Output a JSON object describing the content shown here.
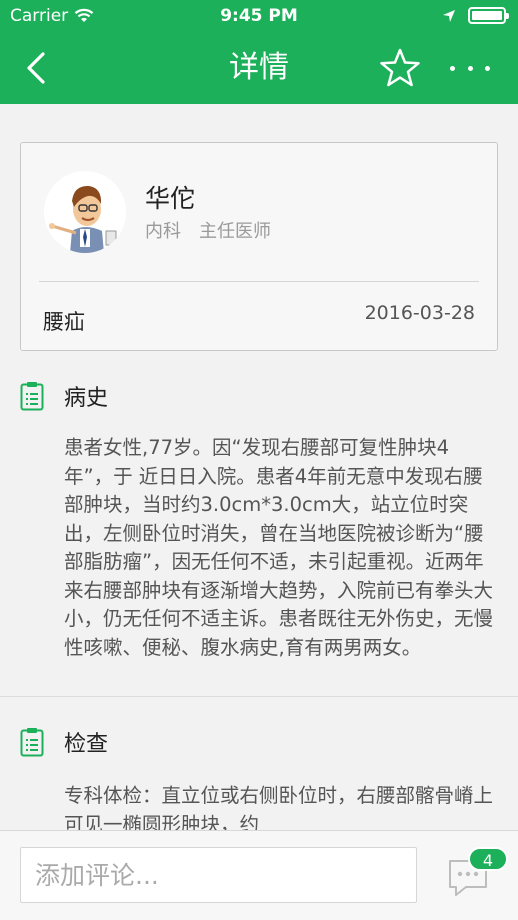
{
  "status_bar": {
    "carrier": "Carrier",
    "time": "9:45 PM"
  },
  "nav": {
    "title": "详情",
    "back_icon": "chevron-left-icon",
    "favorite_icon": "star-icon",
    "more_icon": "more-dots-icon"
  },
  "doctor": {
    "name": "华佗",
    "department": "内科",
    "title": "主任医师"
  },
  "record": {
    "diagnosis": "腰疝",
    "date": "2016-03-28"
  },
  "sections": [
    {
      "title": "病史",
      "icon": "clipboard-icon",
      "text": "患者女性,77岁。因“发现右腰部可复性肿块4年”，于 近日日入院。患者4年前无意中发现右腰部肿块，当时约3.0cm*3.0cm大，站立位时突出，左侧卧位时消失，曾在当地医院被诊断为“腰部脂肪瘤”，因无任何不适，未引起重视。近两年来右腰部肿块有逐渐增大趋势，入院前已有拳头大小，仍无任何不适主诉。患者既往无外伤史，无慢性咳嗽、便秘、腹水病史,育有两男两女。"
    },
    {
      "title": "检查",
      "icon": "clipboard-icon",
      "text": "专科体检：直立位或右侧卧位时，右腰部髂骨嵴上可见一椭圆形肿块，约"
    }
  ],
  "comment": {
    "placeholder": "添加评论...",
    "count": "4"
  },
  "colors": {
    "brand_green": "#1db05a"
  }
}
